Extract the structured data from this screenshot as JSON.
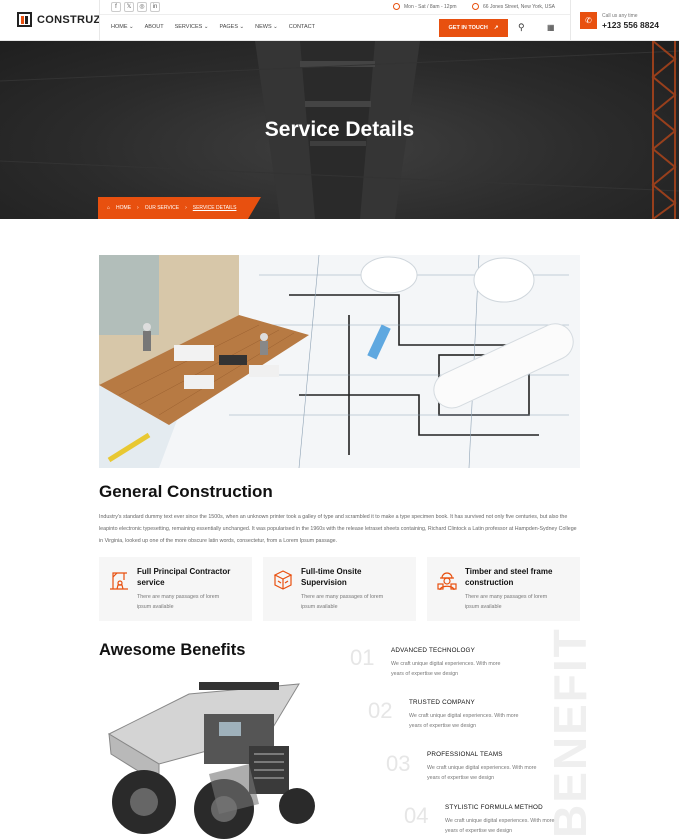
{
  "brand": {
    "name": "CONSTRUZ",
    "accent": "#e8500f"
  },
  "topbar": {
    "social": [
      "f",
      "𝕏",
      "◎",
      "in"
    ],
    "hours": "Mon - Sat / 8am - 12pm",
    "address": "66 Jones Street, New York, USA"
  },
  "nav": {
    "items": [
      "HOME ⌄",
      "ABOUT",
      "SERVICES ⌄",
      "PAGES ⌄",
      "NEWS ⌄",
      "CONTACT"
    ],
    "cta_label": "GET IN TOUCH",
    "call_label": "Call us any time",
    "call_number": "+123 556 8824"
  },
  "hero": {
    "title": "Service Details",
    "breadcrumb": [
      "HOME",
      "OUR SERVICE",
      "SERVICE DETAILS"
    ]
  },
  "main": {
    "heading": "General Construction",
    "paragraph": "Industry's standard dummy text ever since the 1500s, when an unknown printer took a galley of type and scrambled it to make a type specimen book. It has survived not only five centuries, but also the leapinto electronic typesetting, remaining essentially unchanged. It was popularised in the 1960s with the release letraset sheets containing, Richard Clintock a Latin professor at Hampden-Sydney College in Virginia, looked up one of the more obscure latin words, consectetur, from a Lorem Ipsum passage."
  },
  "cards": [
    {
      "title": "Full Principal Contractor service",
      "text": "There are many passages of lorem ipsum available",
      "icon": "crane-worker-icon"
    },
    {
      "title": "Full-time Onsite Supervision",
      "text": "There are many passages of lorem ipsum available",
      "icon": "blueprint-icon"
    },
    {
      "title": "Timber and steel frame construction",
      "text": "There are many passages of lorem ipsum available",
      "icon": "engineer-icon"
    }
  ],
  "benefits": {
    "heading": "Awesome Benefits",
    "watermark": "BENEFIT",
    "items": [
      {
        "num": "01",
        "title": "ADVANCED TECHNOLOGY",
        "text": "We craft unique digital experiences. With more years of expertise we design"
      },
      {
        "num": "02",
        "title": "TRUSTED COMPANY",
        "text": "We craft unique digital experiences. With more years of expertise we design"
      },
      {
        "num": "03",
        "title": "PROFESSIONAL TEAMS",
        "text": "We craft unique digital experiences. With more years of expertise we design"
      },
      {
        "num": "04",
        "title": "STYLISTIC FORMULA METHOD",
        "text": "We craft unique digital experiences. With more years of expertise we design"
      }
    ]
  }
}
